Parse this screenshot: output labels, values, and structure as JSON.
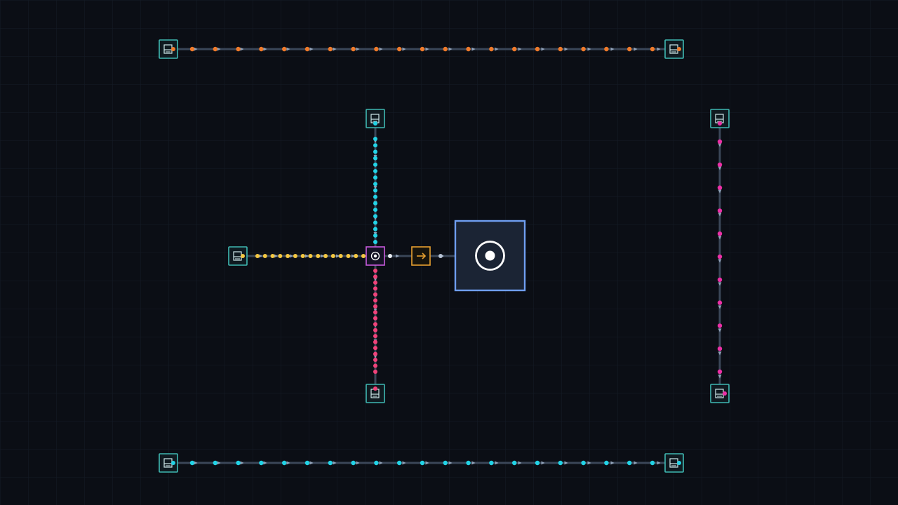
{
  "colors": {
    "background": "#0b0e15",
    "grid": "#151c26",
    "belt": "#3a4658",
    "belt_arrow": "#9fb0c8",
    "node_border": "#3fb8b2",
    "node_fill": "#0f1a20",
    "orange_item": "#f07a2a",
    "cyan_item": "#22d3e6",
    "magenta_item": "#ec2fa6",
    "pink_item": "#f0427a",
    "yellow_item": "#f5c842",
    "white_item": "#e8ecf2",
    "merger_border": "#c85adc",
    "arrow_block_border": "#e8a030",
    "hub_border": "#6f9ef0",
    "hub_fill": "#1b2434",
    "hub_symbol": "#ffffff"
  },
  "icons": {
    "source_node": "extractor-icon",
    "merger": "merger-icon",
    "direction_block": "arrow-right-icon",
    "hub": "target-icon"
  },
  "grid": {
    "visible": true
  }
}
